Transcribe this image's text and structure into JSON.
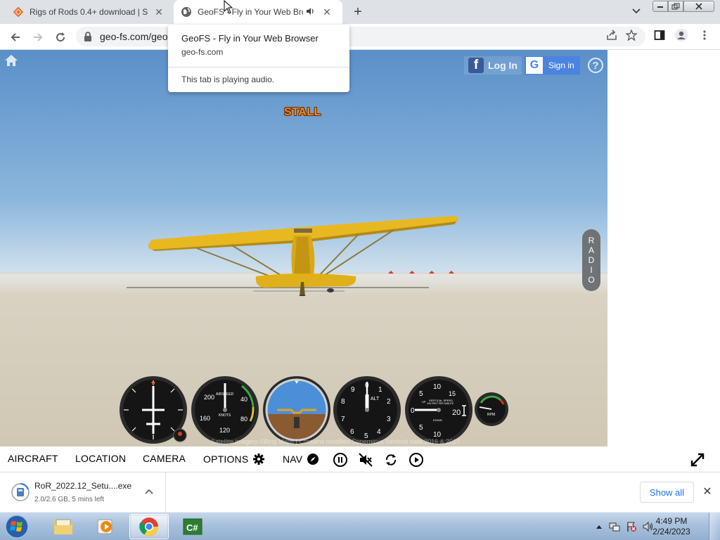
{
  "browser": {
    "tabs": [
      {
        "title": "Rigs of Rods 0.4+ download | So",
        "icon": "sourceforge-icon",
        "active": false
      },
      {
        "title": "GeoFS - Fly in Your Web Bro",
        "icon": "globe-icon",
        "active": true,
        "playing_audio": true
      }
    ],
    "address": "geo-fs.com/geo",
    "hovercard": {
      "title": "GeoFS - Fly in Your Web Browser",
      "domain": "geo-fs.com",
      "audio_note": "This tab is playing audio."
    }
  },
  "geofs": {
    "login_label": "Log In",
    "signin_label": "Sign in",
    "stall_warning": "STALL",
    "radio_letters": [
      "R",
      "A",
      "D",
      "I",
      "O"
    ],
    "credits": "Satellite imagery ©Bing Maps | Contains modified Copernicus Sentinel data 2016 & 2017",
    "gauges": {
      "airspeed": {
        "label": "AIRSPEED",
        "unit": "KNOTS",
        "ticks": [
          "200",
          "40",
          "160",
          "80",
          "120"
        ]
      },
      "altimeter": {
        "label": "ALT",
        "ticks": [
          "0",
          "1",
          "2",
          "3",
          "4",
          "5",
          "6",
          "7",
          "8",
          "9"
        ]
      },
      "vertical_speed": {
        "label": "VERTICAL SPEED",
        "sublabel": "100 FEET PER MINUTE",
        "up": "UP",
        "down": "DOWN",
        "ticks": [
          "10",
          "5",
          "0",
          "20",
          "15",
          "5",
          "10"
        ]
      },
      "rpm": {
        "label": "RPM"
      }
    },
    "menu": {
      "aircraft": "AIRCRAFT",
      "location": "LOCATION",
      "camera": "CAMERA",
      "options": "OPTIONS",
      "nav": "NAV"
    }
  },
  "download": {
    "filename": "RoR_2022.12_Setu....exe",
    "status": "2.0/2.6 GB, 5 mins left",
    "show_all": "Show all"
  },
  "taskbar": {
    "time": "4:49 PM",
    "date": "2/24/2023",
    "apps": [
      "windows-explorer",
      "media-player",
      "chrome",
      "csharp-app"
    ]
  },
  "colors": {
    "stall": "#f08a1c",
    "accent_blue": "#1a73e8",
    "airplane_yellow": "#e8b820"
  }
}
